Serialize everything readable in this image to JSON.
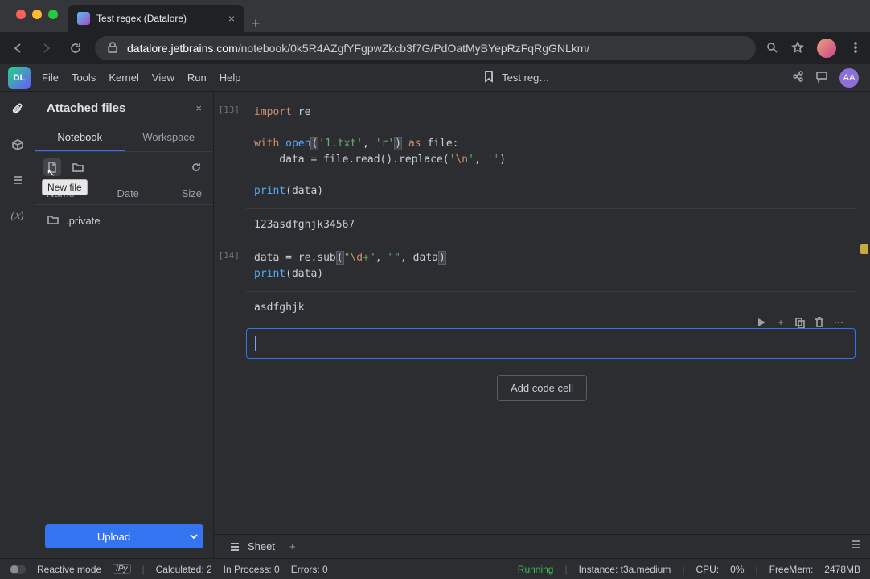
{
  "browser": {
    "tab_title": "Test regex (Datalore)",
    "url_domain": "datalore.jetbrains.com",
    "url_path": "/notebook/0k5R4AZgfYFgpwZkcb3f7G/PdOatMyBYepRzFqRgGNLkm/"
  },
  "menu": {
    "file": "File",
    "tools": "Tools",
    "kernel": "Kernel",
    "view": "View",
    "run": "Run",
    "help": "Help"
  },
  "title": "Test reg…",
  "avatar_initials": "AA",
  "side": {
    "title": "Attached files",
    "tab_notebook": "Notebook",
    "tab_workspace": "Workspace",
    "col_name": "Name",
    "col_date": "Date",
    "col_size": "Size",
    "tooltip_new_file": "New file",
    "files": [
      {
        "name": ".private"
      }
    ],
    "upload": "Upload"
  },
  "notebook": {
    "cells": [
      {
        "prompt": "[13]",
        "code_lines": [
          [
            {
              "t": "import",
              "c": "kw"
            },
            {
              "t": " re",
              "c": ""
            }
          ],
          [],
          [
            {
              "t": "with",
              "c": "kw"
            },
            {
              "t": " ",
              "c": ""
            },
            {
              "t": "open",
              "c": "fn"
            },
            {
              "t": "(",
              "c": "brk"
            },
            {
              "t": "'1.txt'",
              "c": "str"
            },
            {
              "t": ", ",
              "c": ""
            },
            {
              "t": "'r'",
              "c": "str"
            },
            {
              "t": ")",
              "c": "brk"
            },
            {
              "t": " ",
              "c": ""
            },
            {
              "t": "as",
              "c": "kw"
            },
            {
              "t": " file:",
              "c": ""
            }
          ],
          [
            {
              "t": "    data = file.read().replace(",
              "c": ""
            },
            {
              "t": "'",
              "c": "str"
            },
            {
              "t": "\\n",
              "c": "esc"
            },
            {
              "t": "'",
              "c": "str"
            },
            {
              "t": ", ",
              "c": ""
            },
            {
              "t": "''",
              "c": "str"
            },
            {
              "t": ")",
              "c": ""
            }
          ],
          [],
          [
            {
              "t": "print",
              "c": "fn"
            },
            {
              "t": "(data)",
              "c": ""
            }
          ]
        ],
        "output": "123asdfghjk34567"
      },
      {
        "prompt": "[14]",
        "code_lines": [
          [
            {
              "t": "data = re.sub",
              "c": ""
            },
            {
              "t": "(",
              "c": "brk"
            },
            {
              "t": "\"",
              "c": "str"
            },
            {
              "t": "\\d",
              "c": "esc"
            },
            {
              "t": "+\"",
              "c": "str"
            },
            {
              "t": ", ",
              "c": ""
            },
            {
              "t": "\"\"",
              "c": "str"
            },
            {
              "t": ", data",
              "c": ""
            },
            {
              "t": ")",
              "c": "brk"
            }
          ],
          [
            {
              "t": "print",
              "c": "fn"
            },
            {
              "t": "(data)",
              "c": ""
            }
          ]
        ],
        "output": "asdfghjk"
      }
    ],
    "add_cell": "Add code cell"
  },
  "sheet": {
    "name": "Sheet"
  },
  "status": {
    "reactive": "Reactive mode",
    "ipy": "IPy",
    "calculated": "Calculated: 2",
    "in_process": "In Process: 0",
    "errors": "Errors: 0",
    "running": "Running",
    "instance": "Instance: t3a.medium",
    "cpu": "CPU:",
    "cpu_val": "0%",
    "freemem_label": "FreeMem:",
    "freemem_val": "2478MB"
  }
}
